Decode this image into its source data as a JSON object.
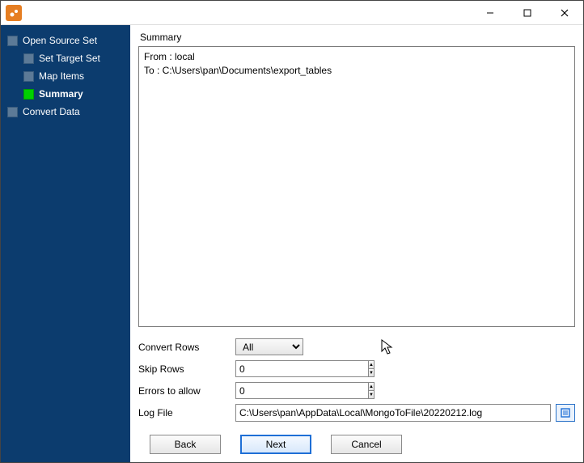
{
  "sidebar": {
    "steps": [
      {
        "label": "Open Source Set",
        "active": false,
        "child": false
      },
      {
        "label": "Set Target Set",
        "active": false,
        "child": true
      },
      {
        "label": "Map Items",
        "active": false,
        "child": true
      },
      {
        "label": "Summary",
        "active": true,
        "child": true
      },
      {
        "label": "Convert Data",
        "active": false,
        "child": false
      }
    ]
  },
  "main": {
    "section_label": "Summary",
    "summary_text": "From : local\nTo : C:\\Users\\pan\\Documents\\export_tables"
  },
  "form": {
    "convert_rows": {
      "label": "Convert Rows",
      "value": "All"
    },
    "skip_rows": {
      "label": "Skip Rows",
      "value": "0"
    },
    "errors_to_allow": {
      "label": "Errors to allow",
      "value": "0"
    },
    "log_file": {
      "label": "Log File",
      "value": "C:\\Users\\pan\\AppData\\Local\\MongoToFile\\20220212.log"
    }
  },
  "buttons": {
    "back": "Back",
    "next": "Next",
    "cancel": "Cancel"
  }
}
